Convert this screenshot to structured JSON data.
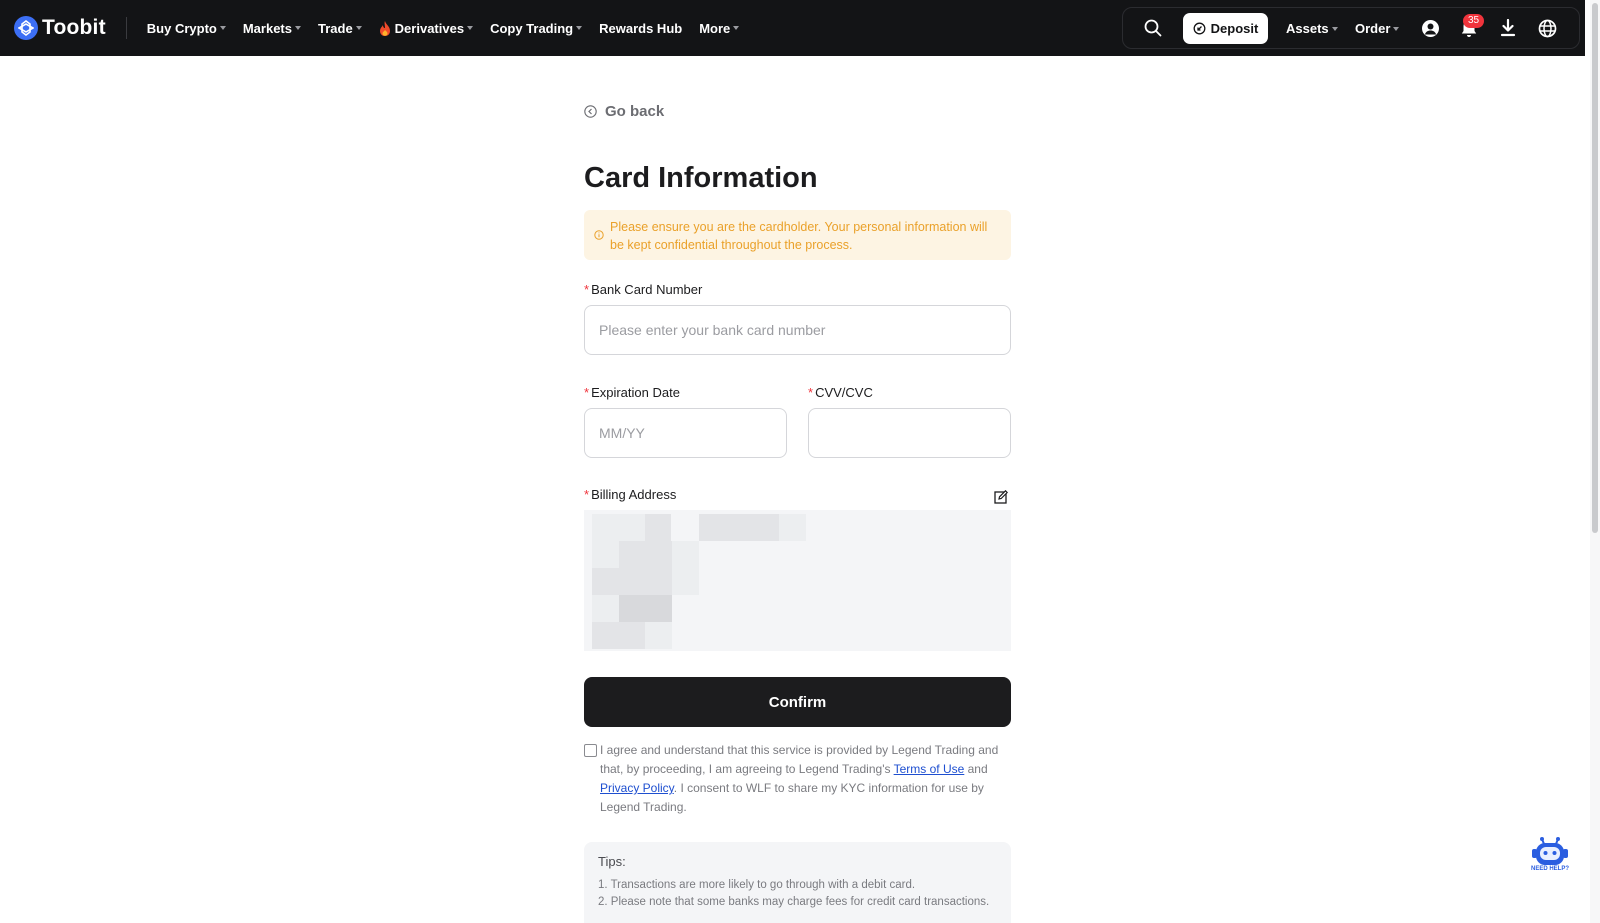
{
  "brand": {
    "name": "Toobit",
    "logo_icon": "toobit-logo-icon"
  },
  "nav": {
    "items": [
      {
        "label": "Buy Crypto",
        "dropdown": true
      },
      {
        "label": "Markets",
        "dropdown": true
      },
      {
        "label": "Trade",
        "dropdown": true
      },
      {
        "label": "Derivatives",
        "dropdown": true,
        "icon": "flame-icon"
      },
      {
        "label": "Copy Trading",
        "dropdown": true
      },
      {
        "label": "Rewards Hub",
        "dropdown": false
      },
      {
        "label": "More",
        "dropdown": true
      }
    ],
    "deposit_label": "Deposit",
    "assets_label": "Assets",
    "order_label": "Order",
    "notification_count": "35"
  },
  "page": {
    "go_back_label": "Go back",
    "title": "Card Information",
    "notice": "Please ensure you are the cardholder. Your personal information will be kept confidential throughout the process.",
    "fields": {
      "card_number": {
        "label": "Bank Card Number",
        "placeholder": "Please enter your bank card number",
        "value": ""
      },
      "expiration": {
        "label": "Expiration Date",
        "placeholder": "MM/YY",
        "value": ""
      },
      "cvv": {
        "label": "CVV/CVC",
        "placeholder": "",
        "value": ""
      },
      "billing": {
        "label": "Billing Address"
      }
    },
    "required_mark": "*",
    "confirm_label": "Confirm",
    "agreement": {
      "part1": "I agree and understand that this service is provided by Legend Trading and that, by proceeding, I am agreeing to Legend Trading's ",
      "terms_link": "Terms of Use",
      "part2": " and ",
      "privacy_link": "Privacy Policy",
      "part3": ". I consent to WLF to share my KYC information for use by Legend Trading.",
      "checked": false
    },
    "tips": {
      "title": "Tips:",
      "items": [
        "1. Transactions are more likely to go through with a debit card.",
        "2. Please note that some banks may charge fees for credit card transactions."
      ]
    }
  },
  "help": {
    "label": "NEED HELP?"
  },
  "colors": {
    "nav_bg": "#131416",
    "brand_blue": "#3c6ff5",
    "notice_bg": "#fdf4e3",
    "notice_text": "#eaa12a",
    "confirm_bg": "#1c1c1e",
    "required": "#f0343c",
    "link": "#1e4fd0"
  }
}
